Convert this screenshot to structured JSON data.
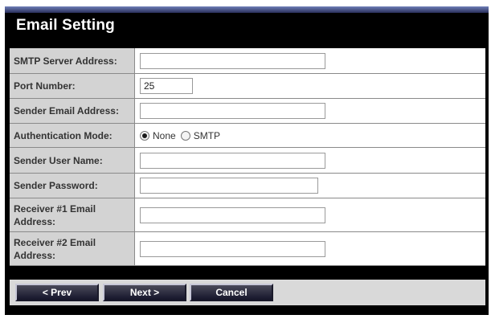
{
  "page": {
    "title": "Email Setting"
  },
  "fields": {
    "smtp_server": {
      "label": "SMTP Server Address:",
      "value": ""
    },
    "port": {
      "label": "Port Number:",
      "value": "25"
    },
    "sender_email": {
      "label": "Sender Email Address:",
      "value": ""
    },
    "auth_mode": {
      "label": "Authentication Mode:",
      "options": [
        "None",
        "SMTP"
      ],
      "selected": "None"
    },
    "sender_user": {
      "label": "Sender User Name:",
      "value": ""
    },
    "sender_password": {
      "label": "Sender Password:",
      "value": ""
    },
    "receiver1": {
      "label": "Receiver #1 Email Address:",
      "value": ""
    },
    "receiver2": {
      "label": "Receiver #2 Email Address:",
      "value": ""
    }
  },
  "buttons": {
    "prev": "< Prev",
    "next": "Next >",
    "cancel": "Cancel"
  },
  "colors": {
    "panel": "#000000",
    "label_bg": "#d3d3d3",
    "button_bar": "#d9d9d9",
    "title_text": "#ffffff"
  }
}
